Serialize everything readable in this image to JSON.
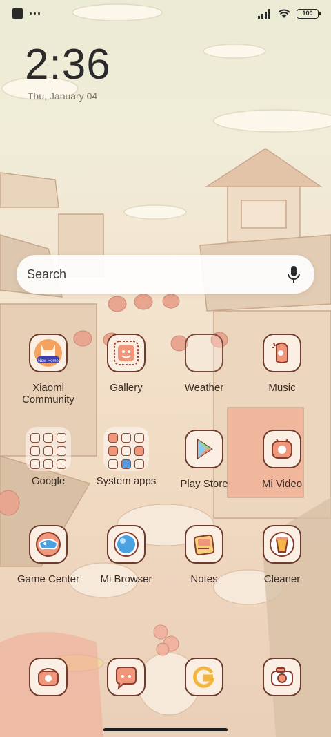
{
  "status_bar": {
    "battery": "100",
    "left_icons": [
      "square-notification-icon",
      "more-dots-icon"
    ],
    "right_icons": [
      "signal-icon",
      "wifi-icon",
      "battery-icon"
    ]
  },
  "clock": {
    "time": "2:36",
    "date": "Thu, January 04"
  },
  "search": {
    "placeholder": "Search",
    "icon": "microphone-icon"
  },
  "apps": {
    "xiaomi_community": {
      "label": "Xiaomi Community",
      "badge": "New Home"
    },
    "gallery": {
      "label": "Gallery"
    },
    "weather": {
      "label": "Weather"
    },
    "music": {
      "label": "Music"
    },
    "google": {
      "label": "Google"
    },
    "system_apps": {
      "label": "System apps"
    },
    "play_store": {
      "label": "Play Store"
    },
    "mi_video": {
      "label": "Mi Video"
    },
    "game_center": {
      "label": "Game Center"
    },
    "mi_browser": {
      "label": "Mi Browser"
    },
    "notes": {
      "label": "Notes"
    },
    "cleaner": {
      "label": "Cleaner"
    }
  },
  "dock": [
    "phone-icon",
    "messaging-icon",
    "chrome-like-icon",
    "camera-icon"
  ],
  "colors": {
    "icon_border": "#6d3c2e",
    "icon_fill": "#fbeee2",
    "text": "#3a2c24"
  }
}
